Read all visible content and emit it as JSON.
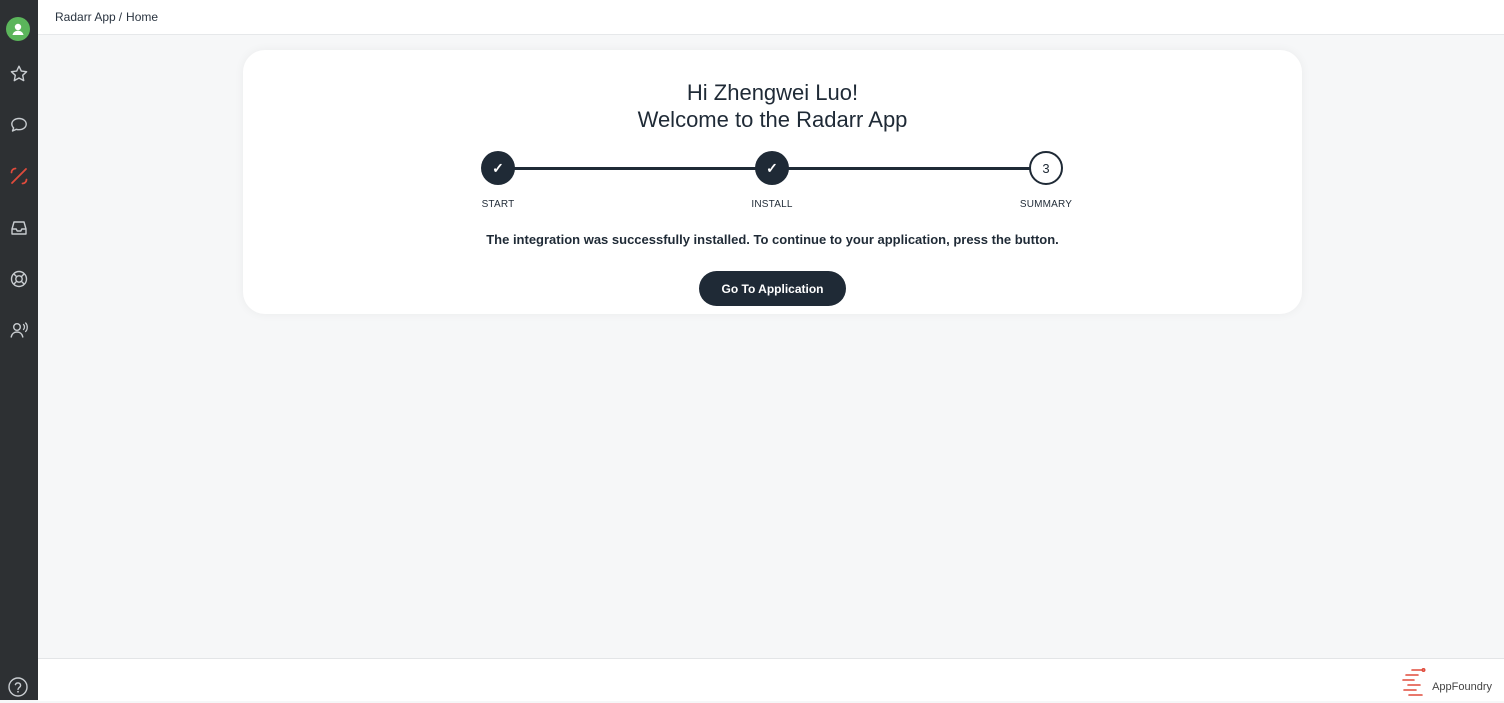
{
  "breadcrumb": {
    "app": "Radarr App",
    "separator": "/",
    "page": "Home"
  },
  "sidebar": {
    "items": [
      {
        "icon": "star-icon"
      },
      {
        "icon": "chat-icon"
      },
      {
        "icon": "percent-icon",
        "color": "#e04b3c"
      },
      {
        "icon": "inbox-icon"
      },
      {
        "icon": "lifebuoy-icon"
      },
      {
        "icon": "contact-icon"
      }
    ],
    "help_icon": "question-icon"
  },
  "greeting": {
    "line1": "Hi Zhengwei Luo!",
    "line2": "Welcome to the Radarr App"
  },
  "steps": [
    {
      "label": "START",
      "state": "done",
      "mark": "✓"
    },
    {
      "label": "INSTALL",
      "state": "done",
      "mark": "✓"
    },
    {
      "label": "SUMMARY",
      "state": "current",
      "mark": "3"
    }
  ],
  "message": "The integration was successfully installed. To continue to your application, press the button.",
  "cta_label": "Go To Application",
  "footer": {
    "brand": "AppFoundry"
  },
  "colors": {
    "sidebar": "#2d3033",
    "primary": "#1f2a36",
    "accent": "#e04b3c",
    "avatar": "#5bb55b"
  }
}
